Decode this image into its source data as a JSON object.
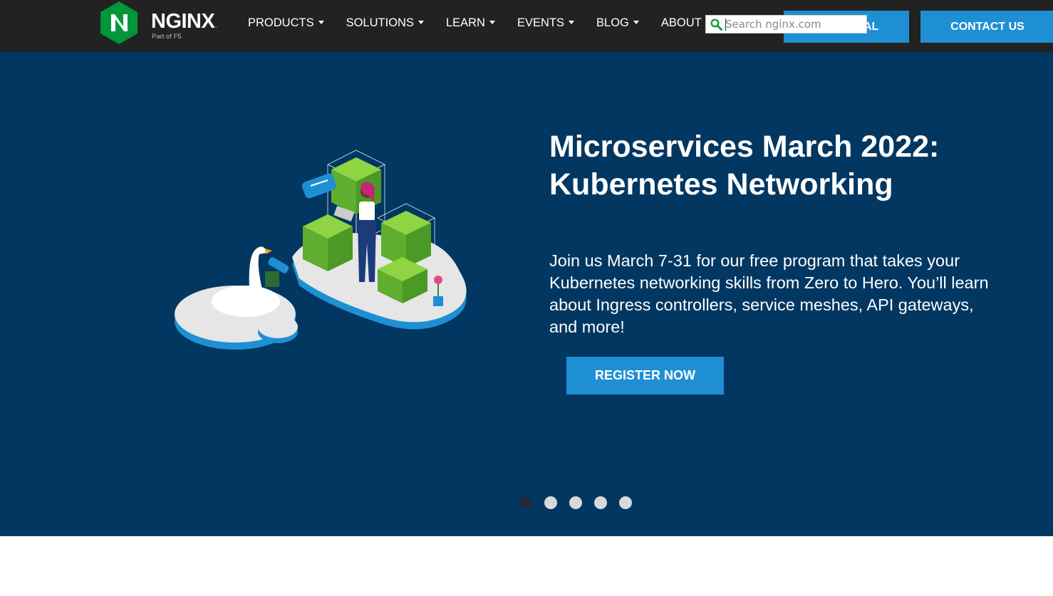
{
  "header": {
    "logo_text": "NGINX",
    "logo_dot": ".",
    "logo_sub": "Part of F5",
    "logo_icon": "nginx-hexagon-logo",
    "nav": [
      {
        "label": "PRODUCTS"
      },
      {
        "label": "SOLUTIONS"
      },
      {
        "label": "LEARN"
      },
      {
        "label": "EVENTS"
      },
      {
        "label": "BLOG"
      },
      {
        "label": "ABOUT"
      }
    ],
    "trial_label": "AL",
    "contact_label": "CONTACT US",
    "search_placeholder": "Search nginx.com"
  },
  "hero": {
    "title": "Microservices March 2022: Kubernetes Networking",
    "description": "Join us March 7-31 for our free program that takes your Kubernetes networking skills from Zero to Hero. You’ll learn about Ingress controllers, service meshes, API gateways, and more!",
    "button_label": "REGISTER NOW",
    "slides_total": 5,
    "active_slide": 1
  },
  "colors": {
    "topbar": "#222222",
    "hero_bg": "#013761",
    "accent": "#1f8fd3",
    "logo_green": "#009639"
  }
}
